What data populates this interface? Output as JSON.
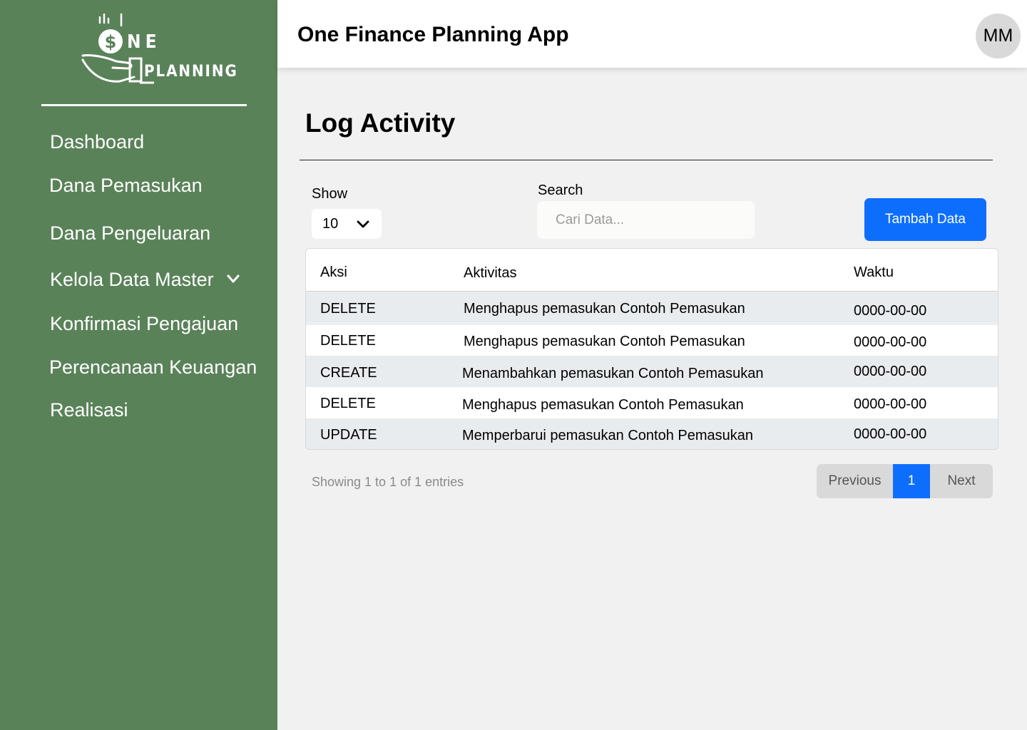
{
  "brand": {
    "logo_word_1": "NE",
    "logo_word_2": "PLANNING"
  },
  "sidebar": {
    "items": [
      {
        "label": "Dashboard"
      },
      {
        "label": "Dana Pemasukan"
      },
      {
        "label": "Dana Pengeluaran"
      },
      {
        "label": "Kelola Data Master",
        "icon": "chevron-down-icon"
      },
      {
        "label": "Konfirmasi Pengajuan"
      },
      {
        "label": "Perencanaan Keuangan"
      },
      {
        "label": "Realisasi"
      }
    ]
  },
  "header": {
    "title": "One Finance Planning App",
    "avatar_initials": "MM"
  },
  "page": {
    "title": "Log Activity"
  },
  "controls": {
    "show_label": "Show",
    "show_value": "10",
    "search_label": "Search",
    "search_placeholder": "Cari Data...",
    "add_button_label": "Tambah Data"
  },
  "table": {
    "columns": [
      "Aksi",
      "Aktivitas",
      "Waktu"
    ],
    "rows": [
      {
        "aksi": "DELETE",
        "aktivitas": "Menghapus pemasukan Contoh Pemasukan",
        "waktu": "0000-00-00"
      },
      {
        "aksi": "DELETE",
        "aktivitas": "Menghapus pemasukan Contoh Pemasukan",
        "waktu": "0000-00-00"
      },
      {
        "aksi": "CREATE",
        "aktivitas": "Menambahkan pemasukan Contoh Pemasukan",
        "waktu": "0000-00-00"
      },
      {
        "aksi": "DELETE",
        "aktivitas": "Menghapus pemasukan Contoh Pemasukan",
        "waktu": "0000-00-00"
      },
      {
        "aksi": "UPDATE",
        "aktivitas": "Memperbarui pemasukan Contoh Pemasukan",
        "waktu": "0000-00-00"
      }
    ]
  },
  "footer": {
    "entries_info": "Showing 1 to 1 of 1 entries",
    "pagination": {
      "previous": "Previous",
      "current": "1",
      "next": "Next"
    }
  },
  "colors": {
    "sidebar": "#5a8259",
    "primary": "#0d6efd",
    "stripe": "#e9ecef",
    "background": "#f1f1f1"
  }
}
